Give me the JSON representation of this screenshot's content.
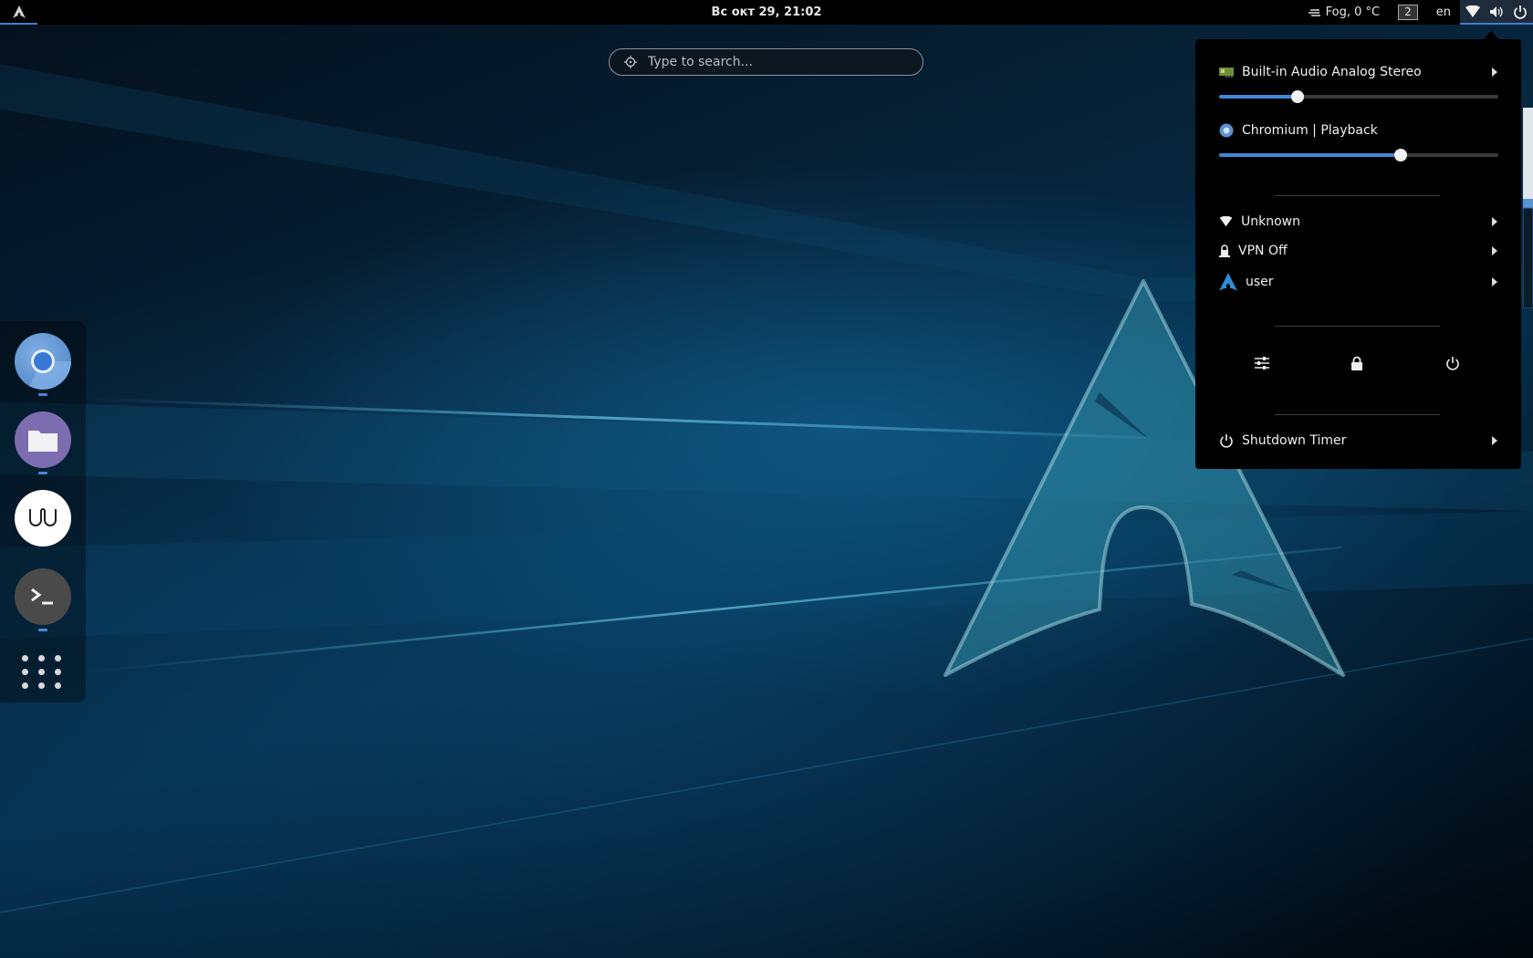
{
  "topbar": {
    "clock": "Вс окт 29, 21:02",
    "weather": "Fog, 0 °C",
    "workspace": "2",
    "keyboard_layout": "en",
    "icons": [
      "arch-logo-icon",
      "weather-fog-icon",
      "wifi-icon",
      "volume-icon",
      "power-icon"
    ]
  },
  "search": {
    "placeholder": "Type to search..."
  },
  "dock": {
    "apps": [
      "chromium",
      "files",
      "wire",
      "terminal"
    ],
    "show_apps_icon": "app-grid-icon"
  },
  "system_menu": {
    "audio_output": {
      "label": "Built-in Audio Analog Stereo",
      "volume": 0.28
    },
    "app_stream": {
      "label": "Chromium | Playback",
      "volume": 0.65
    },
    "network": {
      "label": "Unknown"
    },
    "vpn": {
      "label": "VPN Off"
    },
    "user": {
      "label": "user"
    },
    "actions": [
      "settings-icon",
      "lock-icon",
      "power-icon"
    ],
    "shutdown_timer": {
      "label": "Shutdown Timer"
    }
  },
  "colors": {
    "accent": "#3e87d9",
    "panel": "#000000",
    "chromium": "#5b8fcf",
    "files": "#7c6db1",
    "terminal": "#4a4a4a"
  }
}
